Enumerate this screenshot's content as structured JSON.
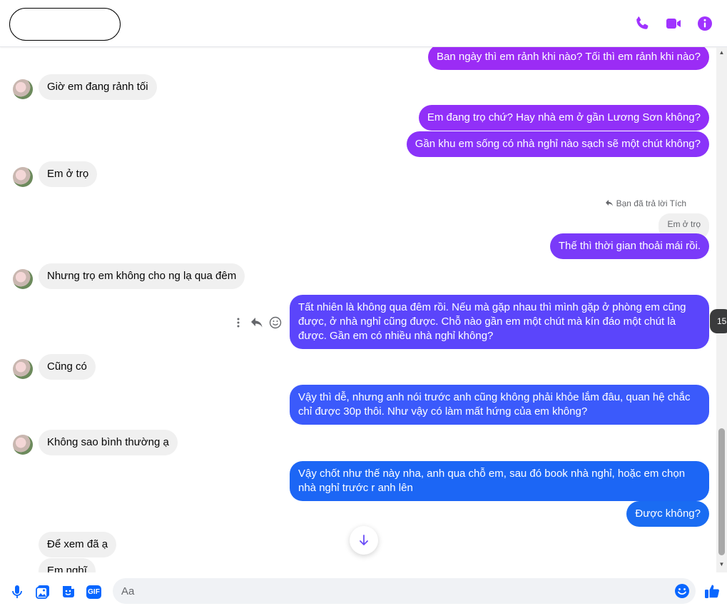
{
  "header": {
    "contact_name": "",
    "icons": [
      "phone-icon",
      "video-call-icon",
      "info-icon"
    ],
    "accent_color": "#a033ff"
  },
  "messages": [
    {
      "side": "out",
      "text": "Ban ngày thì em rảnh khi nào? Tối thì em rảnh khi nào?",
      "color": "#9b2cf5"
    },
    {
      "side": "in",
      "text": "Giờ em đang rảnh tối"
    },
    {
      "side": "out",
      "text": "Em đang trọ chứ? Hay nhà em ở gần Lương Sơn không?",
      "color": "#9130f8"
    },
    {
      "side": "out",
      "text": "Gần khu em sống có nhà nghỉ nào sạch sẽ một chút không?",
      "color": "#8a33f9"
    },
    {
      "side": "in",
      "text": "Em ở trọ"
    },
    {
      "side": "out",
      "text": "Thế thì thời gian thoải mái rồi.",
      "color": "#7a3af9",
      "reply_note": "Bạn đã trả lời Tích",
      "quoted": "Em ở trọ"
    },
    {
      "side": "in",
      "text": "Nhưng trọ em không cho ng lạ qua đêm"
    },
    {
      "side": "out",
      "text": "Tất nhiên là không qua đêm rồi. Nếu mà gặp nhau thì mình gặp ở phòng em cũng được, ở nhà nghỉ cũng được. Chỗ nào gần em một chút mà kín đáo một chút là được. Gần em có nhiều nhà nghỉ không?",
      "color": "#5b45fb"
    },
    {
      "side": "in",
      "text": "Cũng có"
    },
    {
      "side": "out",
      "text": "Vậy thì dễ, nhưng anh nói trước anh cũng không phải khỏe lắm đâu, quan hệ chắc chỉ được 30p thôi. Như vậy có làm mất hứng của em không?",
      "color": "#3b5afb"
    },
    {
      "side": "in",
      "text": "Không sao bình thường ạ"
    },
    {
      "side": "out",
      "text": "Vậy chốt như thế này nha, anh qua chỗ em, sau đó book nhà nghỉ, hoặc em chọn nhà nghỉ trước r anh lên",
      "color": "#1c66f5"
    },
    {
      "side": "out",
      "text": "Được không?",
      "color": "#1a6cf2"
    },
    {
      "side": "in",
      "text": "Để xem đã ạ"
    },
    {
      "side": "in",
      "text": "Em nghĩ"
    }
  ],
  "side_badge": "15",
  "composer": {
    "placeholder": "Aa",
    "icons": [
      "microphone-icon",
      "photo-icon",
      "sticker-icon",
      "gif-icon",
      "emoji-icon",
      "like-icon"
    ],
    "gif_label": "GIF"
  }
}
